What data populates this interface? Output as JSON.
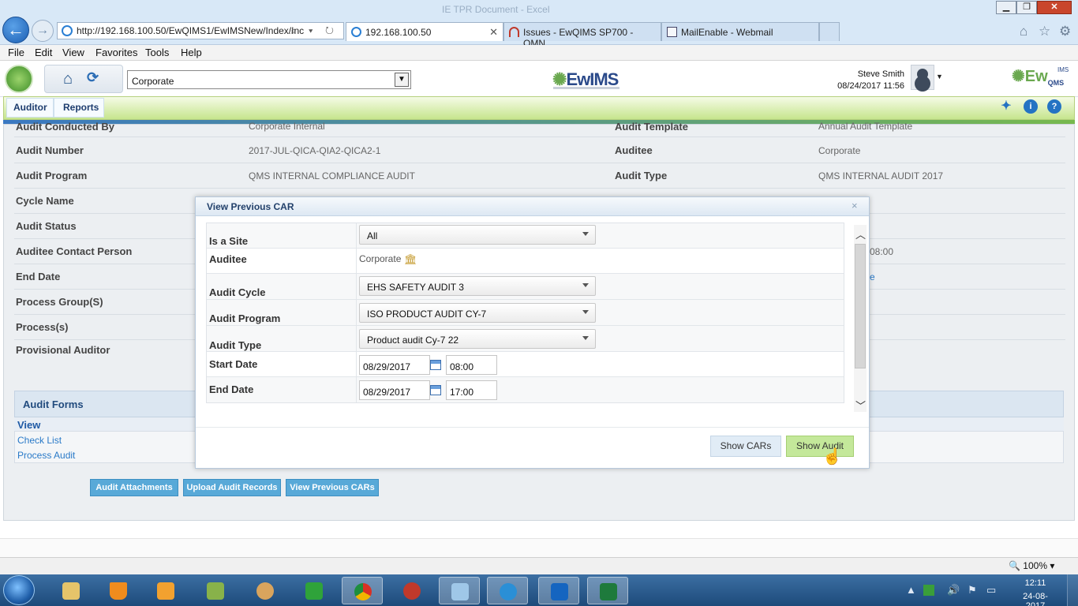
{
  "browser": {
    "window_title": "IE TPR Document - Excel",
    "address": "http://192.168.100.50/EwQIMS1/EwIMSNew/Index/Inc",
    "address_controls": "⌕ ▾ ↻",
    "tabs": [
      {
        "label": "192.168.100.50",
        "active": true
      },
      {
        "label": "Issues - EwQIMS SP700 - OMN..."
      },
      {
        "label": "MailEnable - Webmail"
      }
    ],
    "menu": [
      "File",
      "Edit",
      "View",
      "Favorites",
      "Tools",
      "Help"
    ],
    "zoom": "100%"
  },
  "app": {
    "org_select": "Corporate",
    "brand_center": "EwIMS",
    "brand_right": "Ew",
    "brand_right_sub": "QMS",
    "brand_right_top": "IMS",
    "user_name": "Steve Smith",
    "user_time": "08/24/2017 11:56",
    "nav": [
      "Auditor",
      "Reports"
    ]
  },
  "details": [
    {
      "label": "Audit Conducted By",
      "value": "Corporate Internal",
      "label2": "Audit Template",
      "value2": "Annual Audit Template"
    },
    {
      "label": "Audit Number",
      "value": "2017-JUL-QICA-QIA2-QICA2-1",
      "label2": "Auditee",
      "value2": "Corporate"
    },
    {
      "label": "Audit Program",
      "value": "QMS INTERNAL COMPLIANCE AUDIT",
      "label2": "Audit Type",
      "value2": "QMS INTERNAL AUDIT 2017"
    },
    {
      "label": "Cycle Name"
    },
    {
      "label": "Audit Status"
    },
    {
      "label": "Auditee Contact Person",
      "value2": "08:00"
    },
    {
      "label": "End Date",
      "value2": "e"
    },
    {
      "label": "Process Group(S)"
    },
    {
      "label": "Process(s)"
    },
    {
      "label": "Provisional Auditor"
    }
  ],
  "audit_forms": {
    "title": "Audit Forms",
    "view": "View",
    "links": [
      "Check List",
      "Process Audit"
    ]
  },
  "page_buttons": [
    "Audit Attachments",
    "Upload Audit Records",
    "View Previous CARs"
  ],
  "modal": {
    "title": "View Previous CAR",
    "close": "×",
    "fields": {
      "is_site": {
        "label": "Is a Site",
        "value": "All"
      },
      "auditee": {
        "label": "Auditee",
        "value": "Corporate"
      },
      "audit_cycle": {
        "label": "Audit Cycle",
        "value": "EHS SAFETY AUDIT 3"
      },
      "audit_program": {
        "label": "Audit Program",
        "value": "ISO PRODUCT AUDIT CY-7"
      },
      "audit_type": {
        "label": "Audit Type",
        "value": "Product audit Cy-7 22"
      },
      "start_date": {
        "label": "Start Date",
        "date": "08/29/2017",
        "time": "08:00"
      },
      "end_date": {
        "label": "End Date",
        "date": "08/29/2017",
        "time": "17:00"
      }
    },
    "buttons": {
      "show_cars": "Show CARs",
      "show_audit": "Show Audit"
    }
  },
  "taskbar": {
    "time": "12:11",
    "date": "24-08-2017"
  },
  "colors": {
    "accent_green": "#c6e58d",
    "accent_blue": "#2473c3",
    "button_blue": "#58a9d8"
  }
}
